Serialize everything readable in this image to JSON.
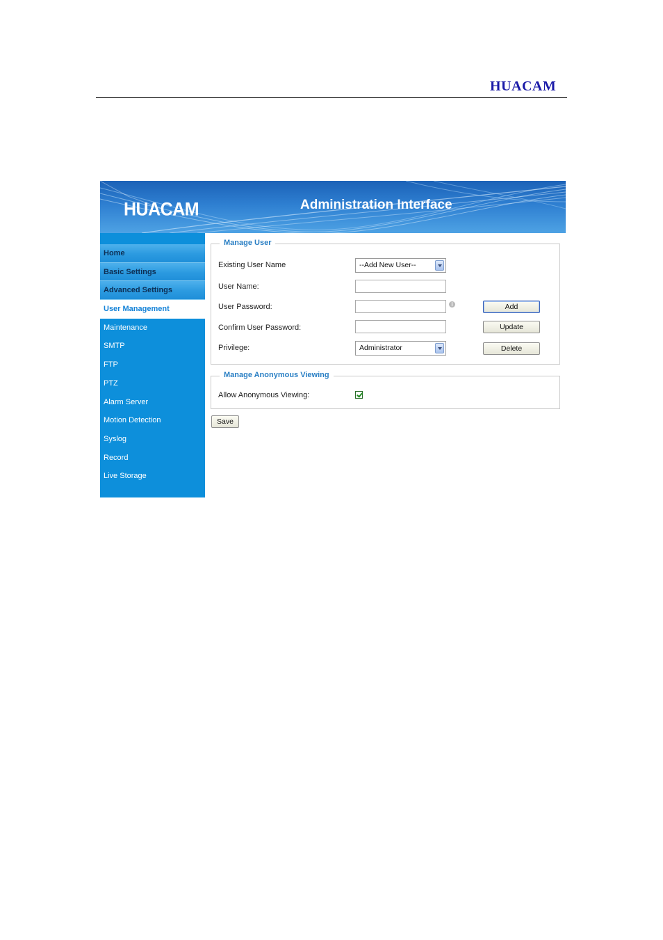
{
  "document": {
    "brand": "HUACAM"
  },
  "banner": {
    "logo": "HUACAM",
    "title": "Administration Interface"
  },
  "sidebar": {
    "items": [
      {
        "label": "Home"
      },
      {
        "label": "Basic Settings"
      },
      {
        "label": "Advanced Settings"
      },
      {
        "label": "User Management",
        "active": true
      },
      {
        "label": "Maintenance"
      },
      {
        "label": "SMTP"
      },
      {
        "label": "FTP"
      },
      {
        "label": "PTZ"
      },
      {
        "label": "Alarm Server"
      },
      {
        "label": "Motion Detection"
      },
      {
        "label": "Syslog"
      },
      {
        "label": "Record"
      },
      {
        "label": "Live Storage"
      }
    ]
  },
  "manage_user": {
    "legend": "Manage User",
    "existing_user_label": "Existing User Name",
    "existing_user_value": "--Add New User--",
    "user_name_label": "User Name:",
    "user_name_value": "",
    "user_password_label": "User Password:",
    "user_password_value": "",
    "password_info_icon": "info-icon",
    "confirm_password_label": "Confirm User Password:",
    "confirm_password_value": "",
    "privilege_label": "Privilege:",
    "privilege_value": "Administrator",
    "add_label": "Add",
    "update_label": "Update",
    "delete_label": "Delete"
  },
  "anonymous": {
    "legend": "Manage Anonymous Viewing",
    "allow_label": "Allow Anonymous Viewing:",
    "allow_checked": true
  },
  "actions": {
    "save_label": "Save"
  },
  "colors": {
    "brand_text": "#1a1aa8",
    "sidebar_bg": "#0d8fdb",
    "legend_text": "#2a7fc4",
    "banner_top": "#1c62b7"
  }
}
